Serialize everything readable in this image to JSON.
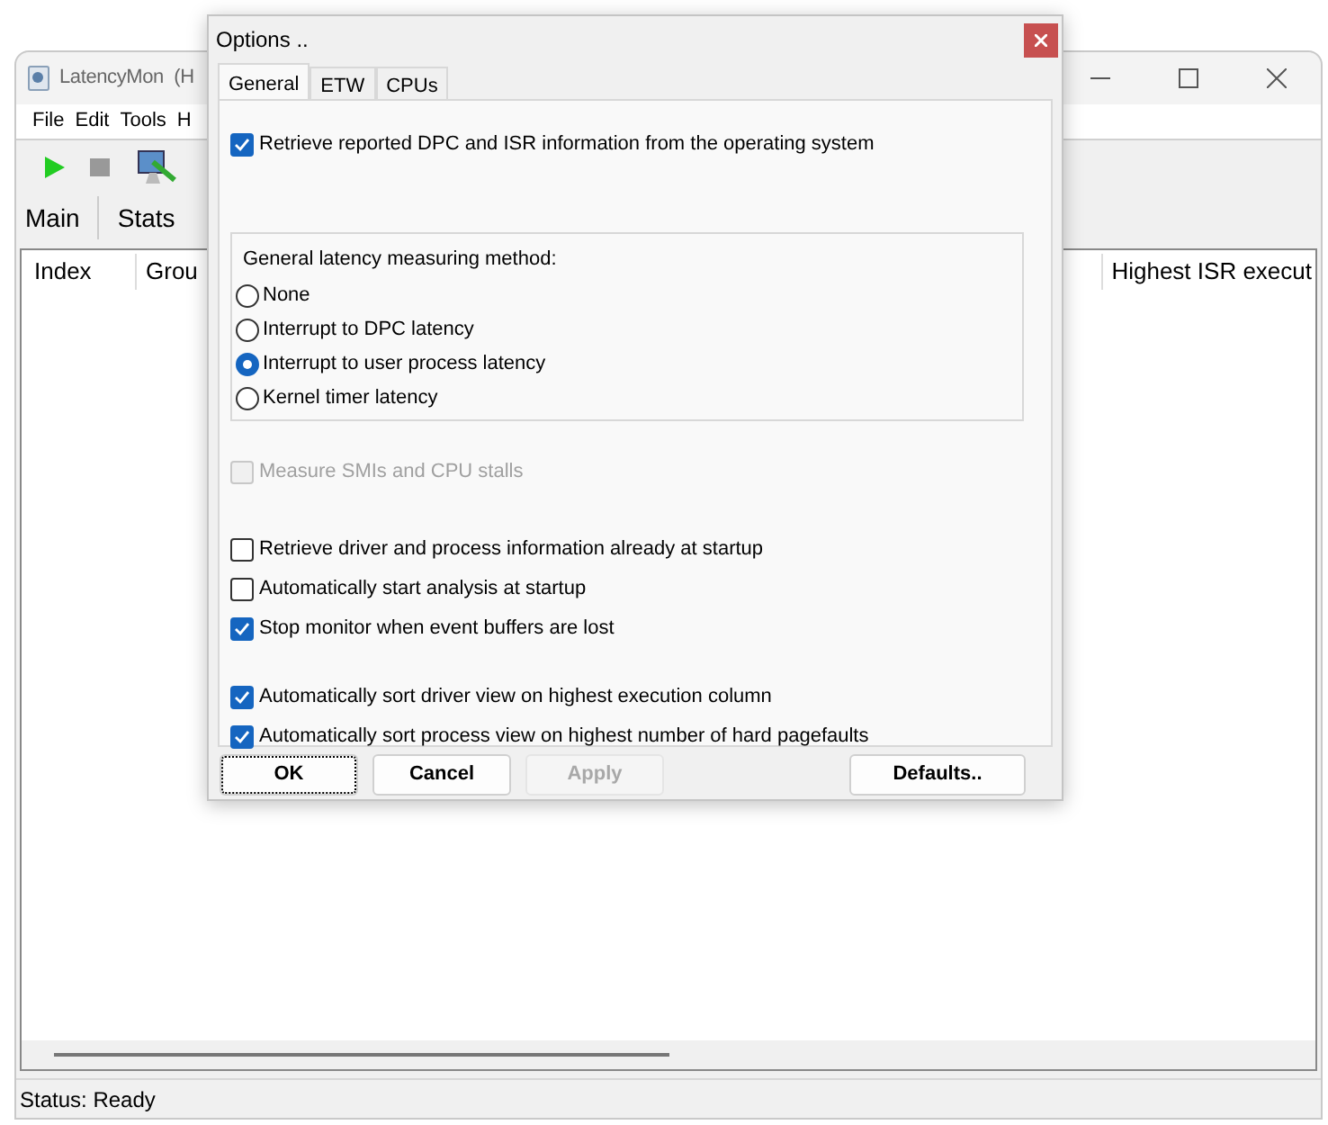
{
  "main_window": {
    "title": "LatencyMon  (H",
    "menu": [
      "File",
      "Edit",
      "Tools",
      "H"
    ],
    "tabs": [
      "Main",
      "Stats"
    ],
    "table": {
      "columns": [
        "Index",
        "Grou",
        "Highest ISR execut"
      ]
    },
    "status_bar": "Status: Ready"
  },
  "dialog": {
    "title": "Options ..",
    "tabs": [
      {
        "label": "General",
        "selected": true
      },
      {
        "label": "ETW",
        "selected": false
      },
      {
        "label": "CPUs",
        "selected": false
      }
    ],
    "sections": [
      {
        "kind": "checks",
        "items": [
          {
            "label": "Retrieve reported DPC and ISR information from the operating system",
            "checked": true,
            "disabled": false
          }
        ]
      },
      {
        "kind": "group",
        "title": "General latency measuring method:",
        "radios": [
          {
            "label": "None",
            "selected": false
          },
          {
            "label": "Interrupt to DPC latency",
            "selected": false
          },
          {
            "label": "Interrupt to user process latency",
            "selected": true
          },
          {
            "label": "Kernel timer latency",
            "selected": false
          }
        ]
      },
      {
        "kind": "checks",
        "items": [
          {
            "label": "Measure SMIs and CPU stalls",
            "checked": false,
            "disabled": true
          }
        ]
      },
      {
        "kind": "checks",
        "items": [
          {
            "label": "Retrieve driver and process information already at startup",
            "checked": false,
            "disabled": false
          },
          {
            "label": "Automatically start analysis at startup",
            "checked": false,
            "disabled": false
          },
          {
            "label": "Stop monitor when event buffers are lost",
            "checked": true,
            "disabled": false
          }
        ]
      },
      {
        "kind": "checks",
        "items": [
          {
            "label": "Automatically sort driver view on highest execution column",
            "checked": true,
            "disabled": false
          },
          {
            "label": "Automatically sort process view on highest number of hard pagefaults",
            "checked": true,
            "disabled": false
          }
        ]
      }
    ],
    "buttons": [
      {
        "label": "OK",
        "disabled": false,
        "focused": true
      },
      {
        "label": "Cancel",
        "disabled": false,
        "focused": false
      },
      {
        "label": "Apply",
        "disabled": true,
        "focused": false
      }
    ],
    "extra_button": {
      "label": "Defaults..",
      "disabled": false,
      "focused": false
    }
  }
}
